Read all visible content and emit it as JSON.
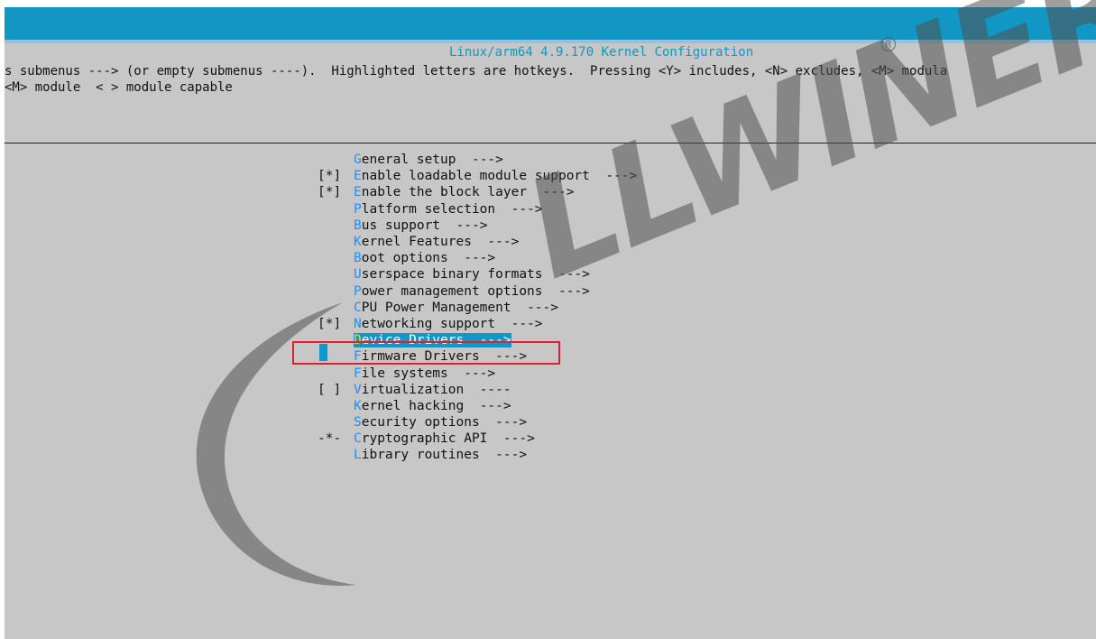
{
  "terminal": {
    "title": "Linux/arm64 4.9.170 Kernel Configuration",
    "help_line_1": "s submenus ---> (or empty submenus ----).  Highlighted letters are hotkeys.  Pressing <Y> includes, <N> excludes, <M> modula",
    "help_line_2": "<M> module  < > module capable"
  },
  "menu": {
    "items": [
      {
        "mark": "",
        "hotkey": "G",
        "rest": "eneral setup",
        "arrow": "  --->"
      },
      {
        "mark": "[*]",
        "hotkey": "E",
        "rest": "nable loadable module support",
        "arrow": "  --->"
      },
      {
        "mark": "[*]",
        "hotkey": "E",
        "rest": "nable the block layer",
        "arrow": "  --->"
      },
      {
        "mark": "",
        "hotkey": "P",
        "rest": "latform selection",
        "arrow": "  --->"
      },
      {
        "mark": "",
        "hotkey": "B",
        "rest": "us support",
        "arrow": "  --->"
      },
      {
        "mark": "",
        "hotkey": "K",
        "rest": "ernel Features",
        "arrow": "  --->"
      },
      {
        "mark": "",
        "hotkey": "B",
        "rest": "oot options",
        "arrow": "  --->"
      },
      {
        "mark": "",
        "hotkey": "U",
        "rest": "serspace binary formats",
        "arrow": "  --->"
      },
      {
        "mark": "",
        "hotkey": "P",
        "rest": "ower management options",
        "arrow": "  --->"
      },
      {
        "mark": "",
        "hotkey": "C",
        "rest": "PU Power Management",
        "arrow": "  --->"
      },
      {
        "mark": "[*]",
        "hotkey": "N",
        "rest": "etworking support",
        "arrow": "  --->"
      },
      {
        "mark": "",
        "hotkey": "D",
        "rest": "evice Drivers",
        "arrow": "  --->"
      },
      {
        "mark": "",
        "hotkey": "F",
        "rest": "irmware Drivers",
        "arrow": "  --->"
      },
      {
        "mark": "",
        "hotkey": "F",
        "rest": "ile systems",
        "arrow": "  --->"
      },
      {
        "mark": "[ ]",
        "hotkey": "V",
        "rest": "irtualization",
        "arrow": "  ----"
      },
      {
        "mark": "",
        "hotkey": "K",
        "rest": "ernel hacking",
        "arrow": "  --->"
      },
      {
        "mark": "",
        "hotkey": "S",
        "rest": "ecurity options",
        "arrow": "  --->"
      },
      {
        "mark": "-*-",
        "hotkey": "C",
        "rest": "ryptographic API",
        "arrow": "  --->"
      },
      {
        "mark": "",
        "hotkey": "L",
        "rest": "ibrary routines",
        "arrow": "  --->"
      }
    ],
    "selected_index": 11
  },
  "watermark": {
    "text": "LLWINER"
  },
  "colors": {
    "title_bar": "#1296c4",
    "terminal_bg": "#c7c7c7",
    "hotkey": "#1e90ff",
    "selection_bg": "#1496c6",
    "selection_hotkey": "#ffd400",
    "annotation_box": "#e0202a"
  }
}
